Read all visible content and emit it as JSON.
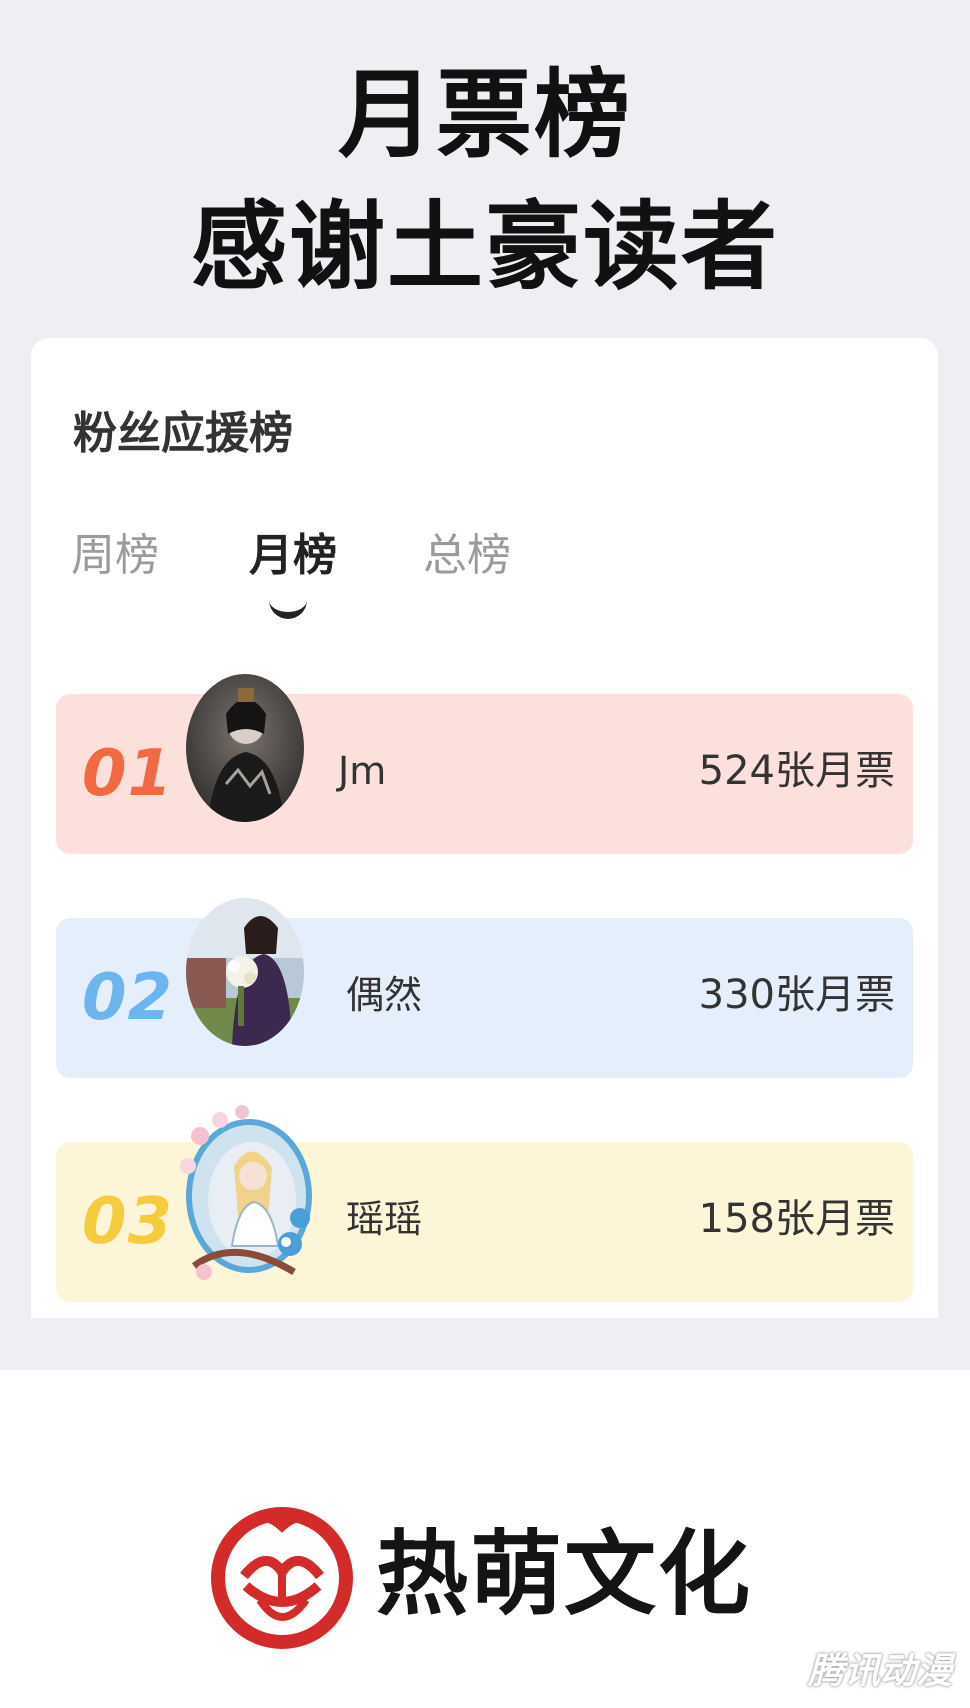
{
  "header": {
    "line1": "月票榜",
    "line2": "感谢土豪读者"
  },
  "card": {
    "title": "粉丝应援榜",
    "tabs": [
      {
        "label": "周榜",
        "active": false
      },
      {
        "label": "月榜",
        "active": true
      },
      {
        "label": "总榜",
        "active": false
      }
    ]
  },
  "ranking": [
    {
      "rank": "01",
      "name": "Jm",
      "votes": "524张月票",
      "accent": "#f26a43",
      "bg": "#fbe0db"
    },
    {
      "rank": "02",
      "name": "偶然",
      "votes": "330张月票",
      "accent": "#6db5ef",
      "bg": "#e4effb"
    },
    {
      "rank": "03",
      "name": "瑶瑶",
      "votes": "158张月票",
      "accent": "#f5cc3d",
      "bg": "#fdf5d8"
    }
  ],
  "brand": {
    "name": "热萌文化",
    "logo_icon": "rose-logo-icon",
    "logo_color": "#d32a2a",
    "watermark": "腾讯动漫"
  }
}
